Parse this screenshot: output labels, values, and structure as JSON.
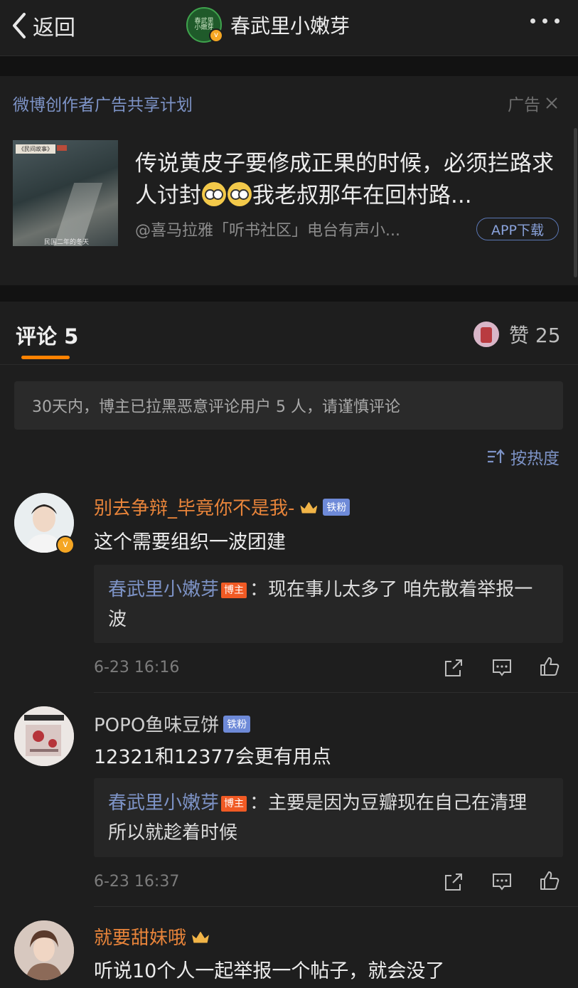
{
  "header": {
    "back_label": "返回",
    "title": "春武里小嫩芽",
    "avatar_text": "春武里\n小嫩芽"
  },
  "ad": {
    "header": "微博创作者广告共享计划",
    "tag": "广告",
    "title_part1": "传说黄皮子要修成正果的时候，必须拦路求人讨封",
    "title_part2": "我老叔那年在回村路...",
    "source": "@喜马拉雅「听书社区」电台有声小...",
    "button": "APP下载",
    "thumb_label": "《民间故事》",
    "thumb_caption": "民国二年的冬天"
  },
  "tabs": {
    "comments_label": "评论 5",
    "likes_label": "赞 25"
  },
  "notice": "30天内，博主已拉黑恶意评论用户 5 人，请谨慎评论",
  "sort_label": "按热度",
  "comments": [
    {
      "name": "别去争辩_毕竟你不是我-",
      "fan_badge": "铁粉",
      "text": "这个需要组织一波团建",
      "reply_name": "春武里小嫩芽",
      "reply_badge": "博主",
      "reply_text": "：现在事儿太多了 咱先散着举报一波",
      "time": "6-23 16:16"
    },
    {
      "name": "POPO鱼味豆饼",
      "fan_badge": "铁粉",
      "text": "12321和12377会更有用点",
      "reply_name": "春武里小嫩芽",
      "reply_badge": "博主",
      "reply_text": "：主要是因为豆瓣现在自己在清理 所以就趁着时候",
      "time": "6-23 16:37"
    },
    {
      "name": "就要甜妹哦",
      "text": "听说10个人一起举报一个帖子，就会没了"
    }
  ],
  "colors": {
    "background": "#1e1e1e",
    "username_orange": "#e8843a",
    "link_blue": "#7d93c6",
    "accent": "#ff8200",
    "bozhu_badge": "#f05a24"
  }
}
